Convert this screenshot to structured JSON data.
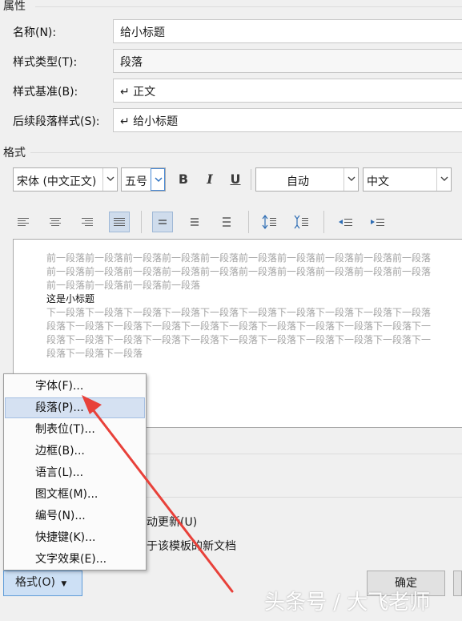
{
  "properties": {
    "title": "属性",
    "name_label": "名称(N):",
    "name_value": "给小标题",
    "type_label": "样式类型(T):",
    "type_value": "段落",
    "based_label": "样式基准(B):",
    "based_value": "↵ 正文",
    "next_label": "后续段落样式(S):",
    "next_value": "↵ 给小标题"
  },
  "format": {
    "title": "格式",
    "font_value": "宋体 (中文正文)",
    "size_value": "五号",
    "bold": "B",
    "italic": "I",
    "underline": "U",
    "color_value": "自动",
    "lang_value": "中文"
  },
  "preview": {
    "prev_lines": [
      "前一段落前一段落前一段落前一段落前一段落前一段落前一段落前一段落前一段落前一段落",
      "前一段落前一段落前一段落前一段落前一段落前一段落前一段落前一段落前一段落前一段落",
      "前一段落前一段落前一段落前一段落"
    ],
    "sample": "这是小标题",
    "next_lines": [
      "下一段落下一段落下一段落下一段落下一段落下一段落下一段落下一段落下一段落下一段落",
      "段落下一段落下一段落下一段落下一段落下一段落下一段落下一段落下一段落下一段落下一",
      "段落下一段落下一段落下一段落下一段落下一段落下一段落下一段落下一段落下一段落下一",
      "段落下一段落下一段落"
    ]
  },
  "options": {
    "auto_update": "动更新(U)",
    "new_docs": "于该模板的新文档"
  },
  "menu": {
    "items": [
      "字体(F)...",
      "段落(P)...",
      "制表位(T)...",
      "边框(B)...",
      "语言(L)...",
      "图文框(M)...",
      "编号(N)...",
      "快捷键(K)...",
      "文字效果(E)..."
    ]
  },
  "buttons": {
    "format_dropdown": "格式(O)",
    "ok": "确定"
  },
  "watermark": "头条号 / 大飞老师",
  "colors": {
    "arrow": "#e8413a",
    "menu_highlight": "#d5e1f2",
    "active_button": "#cfdcec"
  }
}
